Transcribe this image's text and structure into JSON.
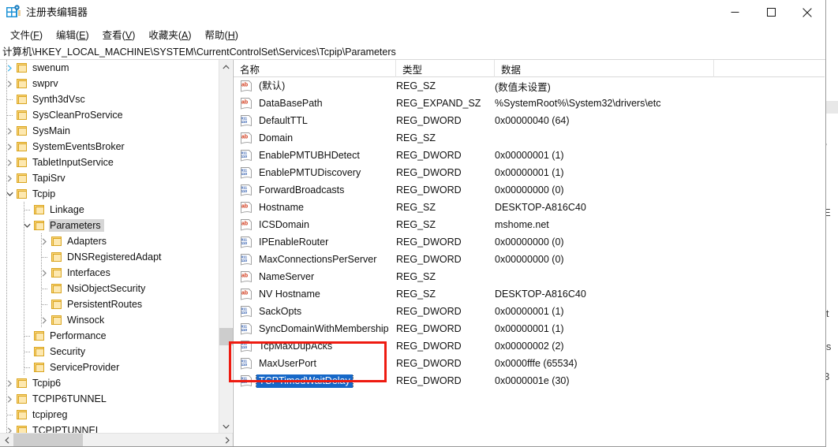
{
  "window": {
    "title": "注册表编辑器",
    "icon": "registry-editor-icon",
    "minimize_label": "最小化",
    "maximize_label": "最大化",
    "close_label": "关闭"
  },
  "menu": {
    "items": [
      {
        "name": "file",
        "label": "文件(F)",
        "text": "文件(",
        "mnemonic": "F",
        "tail": ")"
      },
      {
        "name": "edit",
        "label": "编辑(E)",
        "text": "编辑(",
        "mnemonic": "E",
        "tail": ")"
      },
      {
        "name": "view",
        "label": "查看(V)",
        "text": "查看(",
        "mnemonic": "V",
        "tail": ")"
      },
      {
        "name": "favorites",
        "label": "收藏夹(A)",
        "text": "收藏夹(",
        "mnemonic": "A",
        "tail": ")"
      },
      {
        "name": "help",
        "label": "帮助(H)",
        "text": "帮助(",
        "mnemonic": "H",
        "tail": ")"
      }
    ]
  },
  "address": {
    "path": "计算机\\HKEY_LOCAL_MACHINE\\SYSTEM\\CurrentControlSet\\Services\\Tcpip\\Parameters"
  },
  "tree": {
    "nodes": [
      {
        "label": "swenum",
        "depth": 3,
        "twist": "right-hover",
        "selected": false
      },
      {
        "label": "swprv",
        "depth": 3,
        "twist": "right",
        "selected": false
      },
      {
        "label": "Synth3dVsc",
        "depth": 3,
        "twist": "none",
        "selected": false
      },
      {
        "label": "SysCleanProService",
        "depth": 3,
        "twist": "none",
        "selected": false
      },
      {
        "label": "SysMain",
        "depth": 3,
        "twist": "right",
        "selected": false
      },
      {
        "label": "SystemEventsBroker",
        "depth": 3,
        "twist": "right",
        "selected": false
      },
      {
        "label": "TabletInputService",
        "depth": 3,
        "twist": "right",
        "selected": false
      },
      {
        "label": "TapiSrv",
        "depth": 3,
        "twist": "right",
        "selected": false
      },
      {
        "label": "Tcpip",
        "depth": 3,
        "twist": "down",
        "selected": false
      },
      {
        "label": "Linkage",
        "depth": 4,
        "twist": "none",
        "selected": false
      },
      {
        "label": "Parameters",
        "depth": 4,
        "twist": "down",
        "selected": true
      },
      {
        "label": "Adapters",
        "depth": 5,
        "twist": "right",
        "selected": false
      },
      {
        "label": "DNSRegisteredAdapt",
        "depth": 5,
        "twist": "none",
        "selected": false
      },
      {
        "label": "Interfaces",
        "depth": 5,
        "twist": "right",
        "selected": false
      },
      {
        "label": "NsiObjectSecurity",
        "depth": 5,
        "twist": "none",
        "selected": false
      },
      {
        "label": "PersistentRoutes",
        "depth": 5,
        "twist": "none",
        "selected": false
      },
      {
        "label": "Winsock",
        "depth": 5,
        "twist": "right",
        "selected": false
      },
      {
        "label": "Performance",
        "depth": 4,
        "twist": "none",
        "selected": false
      },
      {
        "label": "Security",
        "depth": 4,
        "twist": "none",
        "selected": false
      },
      {
        "label": "ServiceProvider",
        "depth": 4,
        "twist": "none",
        "selected": false
      },
      {
        "label": "Tcpip6",
        "depth": 3,
        "twist": "right",
        "selected": false
      },
      {
        "label": "TCPIP6TUNNEL",
        "depth": 3,
        "twist": "right",
        "selected": false
      },
      {
        "label": "tcpipreg",
        "depth": 3,
        "twist": "none",
        "selected": false
      },
      {
        "label": "TCPIPTUNNEL",
        "depth": 3,
        "twist": "right",
        "selected": false
      }
    ]
  },
  "list": {
    "columns": [
      {
        "name": "name",
        "label": "名称"
      },
      {
        "name": "type",
        "label": "类型"
      },
      {
        "name": "data",
        "label": "数据"
      }
    ],
    "rows": [
      {
        "name": "(默认)",
        "icon": "string-value-icon",
        "type": "REG_SZ",
        "data": "(数值未设置)",
        "selected": false
      },
      {
        "name": "DataBasePath",
        "icon": "string-value-icon",
        "type": "REG_EXPAND_SZ",
        "data": "%SystemRoot%\\System32\\drivers\\etc",
        "selected": false
      },
      {
        "name": "DefaultTTL",
        "icon": "dword-value-icon",
        "type": "REG_DWORD",
        "data": "0x00000040 (64)",
        "selected": false
      },
      {
        "name": "Domain",
        "icon": "string-value-icon",
        "type": "REG_SZ",
        "data": "",
        "selected": false
      },
      {
        "name": "EnablePMTUBHDetect",
        "icon": "dword-value-icon",
        "type": "REG_DWORD",
        "data": "0x00000001 (1)",
        "selected": false
      },
      {
        "name": "EnablePMTUDiscovery",
        "icon": "dword-value-icon",
        "type": "REG_DWORD",
        "data": "0x00000001 (1)",
        "selected": false
      },
      {
        "name": "ForwardBroadcasts",
        "icon": "dword-value-icon",
        "type": "REG_DWORD",
        "data": "0x00000000 (0)",
        "selected": false
      },
      {
        "name": "Hostname",
        "icon": "string-value-icon",
        "type": "REG_SZ",
        "data": "DESKTOP-A816C40",
        "selected": false
      },
      {
        "name": "ICSDomain",
        "icon": "string-value-icon",
        "type": "REG_SZ",
        "data": "mshome.net",
        "selected": false
      },
      {
        "name": "IPEnableRouter",
        "icon": "dword-value-icon",
        "type": "REG_DWORD",
        "data": "0x00000000 (0)",
        "selected": false
      },
      {
        "name": "MaxConnectionsPerServer",
        "icon": "dword-value-icon",
        "type": "REG_DWORD",
        "data": "0x00000000 (0)",
        "selected": false
      },
      {
        "name": "NameServer",
        "icon": "string-value-icon",
        "type": "REG_SZ",
        "data": "",
        "selected": false
      },
      {
        "name": "NV Hostname",
        "icon": "string-value-icon",
        "type": "REG_SZ",
        "data": "DESKTOP-A816C40",
        "selected": false
      },
      {
        "name": "SackOpts",
        "icon": "dword-value-icon",
        "type": "REG_DWORD",
        "data": "0x00000001 (1)",
        "selected": false
      },
      {
        "name": "SyncDomainWithMembership",
        "icon": "dword-value-icon",
        "type": "REG_DWORD",
        "data": "0x00000001 (1)",
        "selected": false
      },
      {
        "name": "TcpMaxDupAcks",
        "icon": "dword-value-icon",
        "type": "REG_DWORD",
        "data": "0x00000002 (2)",
        "selected": false
      },
      {
        "name": "MaxUserPort",
        "icon": "dword-value-icon",
        "type": "REG_DWORD",
        "data": "0x0000fffe (65534)",
        "selected": false
      },
      {
        "name": "TCPTimedWaitDelay",
        "icon": "dword-value-icon",
        "type": "REG_DWORD",
        "data": "0x0000001e (30)",
        "selected": true
      }
    ]
  },
  "annotation": {
    "highlight_color": "#ee1b11",
    "highlight_rows": [
      "MaxUserPort",
      "TCPTimedWaitDelay"
    ]
  },
  "colors": {
    "selection_blue": "#1668c8",
    "tree_selection_gray": "#d6d6d6",
    "folder_yellow": "#fcd77f"
  }
}
